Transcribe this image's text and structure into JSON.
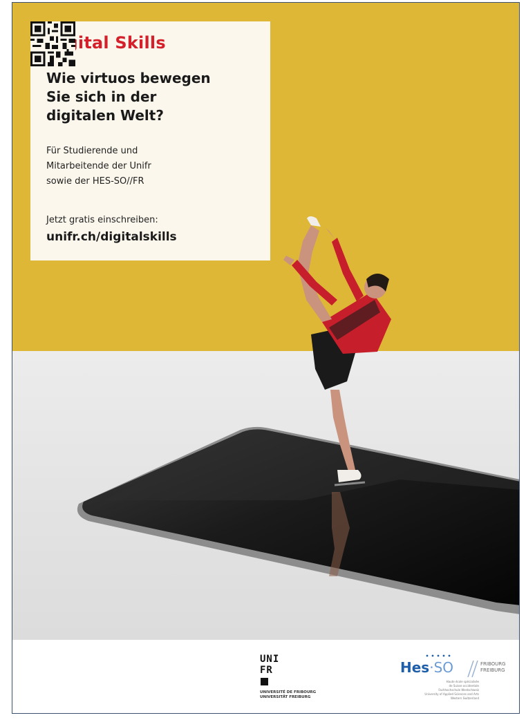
{
  "brand": {
    "title": "Digital Skills"
  },
  "headline": [
    "Wie virtuos bewegen",
    "Sie sich in der",
    "digitalen Welt?"
  ],
  "audience": [
    "Für Studierende und",
    "Mitarbeitende der Unifr",
    "sowie der HES-SO//FR"
  ],
  "cta": {
    "text": "Jetzt gratis einschreiben:",
    "url": "unifr.ch/digitalskills"
  },
  "colors": {
    "accent_red": "#d3202a",
    "wall_yellow": "#dfb737",
    "card_bg": "#fbf7ec",
    "hes_blue": "#1f5fa9"
  },
  "footer": {
    "unifr": {
      "wordmark": [
        "UNI",
        "FR"
      ],
      "lines": [
        "UNIVERSITÉ DE FRIBOURG",
        "UNIVERSITÄT FREIBURG"
      ]
    },
    "hesso": {
      "logo_main": "Hes",
      "logo_sep": "·",
      "logo_so": "SO",
      "city": [
        "FRIBOURG",
        "FREIBURG"
      ],
      "desc": [
        "Haute école spécialisée",
        "de Suisse occidentale",
        "Fachhochschule Westschweiz",
        "University of Applied Sciences and Arts",
        "Western Switzerland"
      ]
    }
  }
}
